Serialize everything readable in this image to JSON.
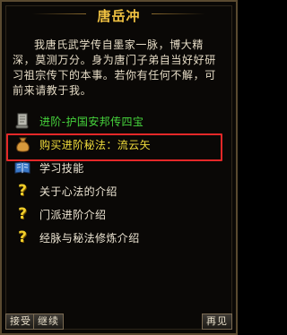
{
  "dialog": {
    "title": "唐岳冲",
    "description": "我唐氏武学传自墨家一脉，博大精深，莫测万分。身为唐门子弟自当好好研习祖宗传下的本事。若你有任何不解，可前来请教于我。"
  },
  "options": [
    {
      "label": "进阶-护国安邦传四宝",
      "icon": "scroll-icon",
      "color": "#46d43c"
    },
    {
      "label": "购买进阶秘法：流云矢",
      "icon": "money-bag-icon",
      "color": "#f0dc3c"
    },
    {
      "label": "学习技能",
      "icon": "book-icon",
      "color": "#ece4d2"
    },
    {
      "label": "关于心法的介绍",
      "icon": "question-mark-icon",
      "color": "#ece4d2"
    },
    {
      "label": "门派进阶介绍",
      "icon": "question-mark-icon",
      "color": "#ece4d2"
    },
    {
      "label": "经脉与秘法修炼介绍",
      "icon": "question-mark-icon",
      "color": "#ece4d2"
    }
  ],
  "buttons": {
    "accept": "接受",
    "continue": "继续",
    "goodbye": "再见"
  }
}
